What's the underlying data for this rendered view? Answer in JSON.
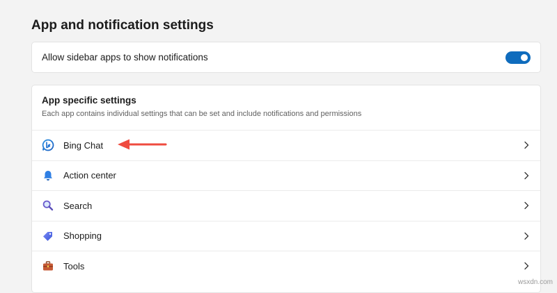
{
  "page": {
    "title": "App and notification settings"
  },
  "notifications": {
    "label": "Allow sidebar apps to show notifications",
    "enabled": true,
    "toggle_color": "#0f6cbd"
  },
  "app_specific": {
    "title": "App specific settings",
    "description": "Each app contains individual settings that can be set and include notifications and permissions",
    "apps": [
      {
        "label": "Bing Chat",
        "icon": "bing-chat-icon"
      },
      {
        "label": "Action center",
        "icon": "bell-icon"
      },
      {
        "label": "Search",
        "icon": "search-icon"
      },
      {
        "label": "Shopping",
        "icon": "shopping-tag-icon"
      },
      {
        "label": "Tools",
        "icon": "toolbox-icon"
      }
    ]
  },
  "annotation": {
    "arrow_color": "#ef4b3f"
  },
  "watermark": "wsxdn.com"
}
